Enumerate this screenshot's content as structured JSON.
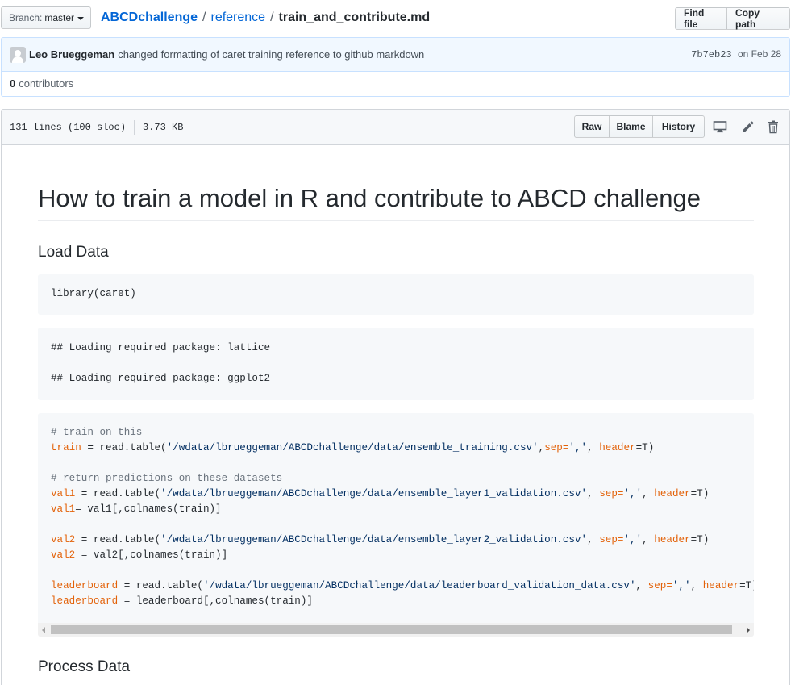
{
  "branch": {
    "prefix": "Branch:",
    "name": "master"
  },
  "breadcrumb": {
    "repo": "ABCDchallenge",
    "folder": "reference",
    "file": "train_and_contribute.md",
    "separator": "/"
  },
  "path_actions": {
    "find_file": "Find file",
    "copy_path": "Copy path"
  },
  "commit": {
    "author": "Leo Brueggeman",
    "message": "changed formatting of caret training reference to github markdown",
    "sha": "7b7eb23",
    "date": "on Feb 28"
  },
  "contributors": {
    "count": "0",
    "label": "contributors"
  },
  "file": {
    "lines": "131 lines (100 sloc)",
    "size": "3.73 KB",
    "actions": {
      "raw": "Raw",
      "blame": "Blame",
      "history": "History"
    },
    "icons": [
      "desktop-icon",
      "pencil-icon",
      "trash-icon"
    ]
  },
  "markdown": {
    "title": "How to train a model in R and contribute to ABCD challenge",
    "section1": "Load Data",
    "code1": "library(caret)",
    "output1": [
      "## Loading required package: lattice",
      "## Loading required package: ggplot2"
    ],
    "code2": {
      "comment1": "# train on this",
      "l1_var": "train",
      "l1_eq": " = read.table(",
      "l1_str": "'/wdata/lbrueggeman/ABCDchallenge/data/ensemble_training.csv'",
      "l1_a": ",",
      "l1_sep": "sep",
      "l1_b": "=",
      "l1_sepval": "','",
      "l1_c": ", ",
      "l1_header": "header",
      "l1_d": "=T)",
      "comment2": "# return predictions on these datasets",
      "l2_var": "val1",
      "l2_eq": " = read.table(",
      "l2_str": "'/wdata/lbrueggeman/ABCDchallenge/data/ensemble_layer1_validation.csv'",
      "l2_a": ", ",
      "l2_sep": "sep",
      "l2_b": "=",
      "l2_sepval": "','",
      "l2_c": ", ",
      "l2_header": "header",
      "l2_d": "=T)",
      "l3_var": "val1",
      "l3_rest": "= val1[,colnames(train)]",
      "l4_var": "val2",
      "l4_eq": " = read.table(",
      "l4_str": "'/wdata/lbrueggeman/ABCDchallenge/data/ensemble_layer2_validation.csv'",
      "l4_a": ", ",
      "l4_sep": "sep",
      "l4_b": "=",
      "l4_sepval": "','",
      "l4_c": ", ",
      "l4_header": "header",
      "l4_d": "=T)",
      "l5_var": "val2",
      "l5_rest": " = val2[,colnames(train)]",
      "l6_var": "leaderboard",
      "l6_eq": " = read.table(",
      "l6_str": "'/wdata/lbrueggeman/ABCDchallenge/data/leaderboard_validation_data.csv'",
      "l6_a": ", ",
      "l6_sep": "sep",
      "l6_b": "=",
      "l6_sepval": "','",
      "l6_c": ", ",
      "l6_header": "header",
      "l6_d": "=T)",
      "l7_var": "leaderboard",
      "l7_rest": " = leaderboard[,colnames(train)]"
    },
    "section2": "Process Data"
  },
  "colors": {
    "link": "#0366d6",
    "variable": "#e36209",
    "comment": "#6a737d",
    "string": "#032f62"
  }
}
